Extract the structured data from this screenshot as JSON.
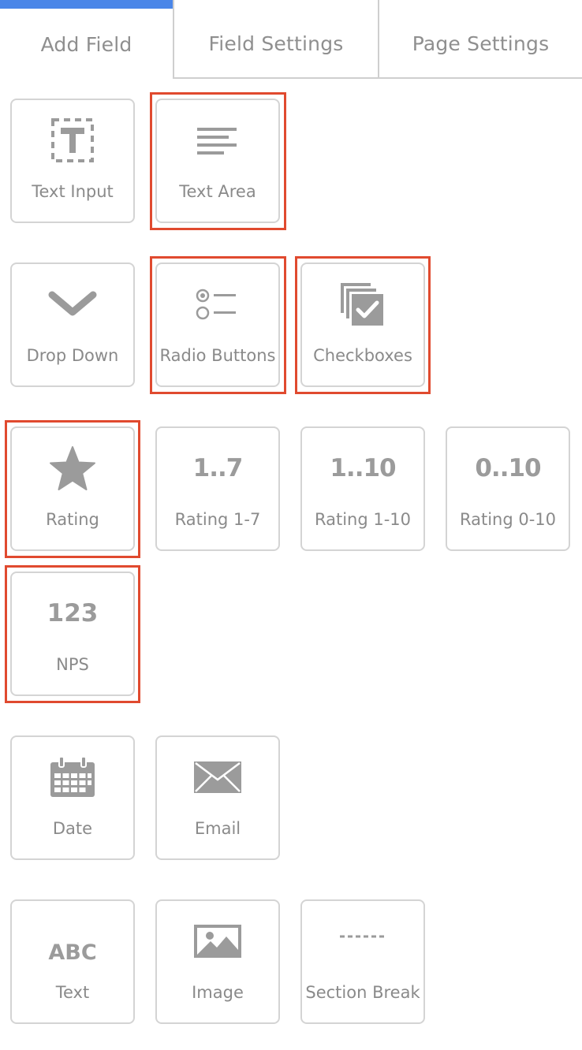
{
  "tabs": {
    "add_field": "Add Field",
    "field_settings": "Field Settings",
    "page_settings": "Page Settings"
  },
  "fields": {
    "text_input": "Text Input",
    "text_area": "Text Area",
    "drop_down": "Drop Down",
    "radio_buttons": "Radio Buttons",
    "checkboxes": "Checkboxes",
    "rating": "Rating",
    "rating_1_7": "Rating 1-7",
    "rating_1_10": "Rating 1-10",
    "rating_0_10": "Rating 0-10",
    "nps": "NPS",
    "date": "Date",
    "email": "Email",
    "text": "Text",
    "image": "Image",
    "section_break": "Section Break"
  },
  "icon_text": {
    "rating_1_7": "1..7",
    "rating_1_10": "1..10",
    "rating_0_10": "0..10",
    "nps": "123",
    "text": "ABC"
  },
  "colors": {
    "active_tab": "#4a86e8",
    "highlight": "#e04a2f",
    "icon": "#9b9b9b",
    "tile_border": "#d4d4d4"
  }
}
